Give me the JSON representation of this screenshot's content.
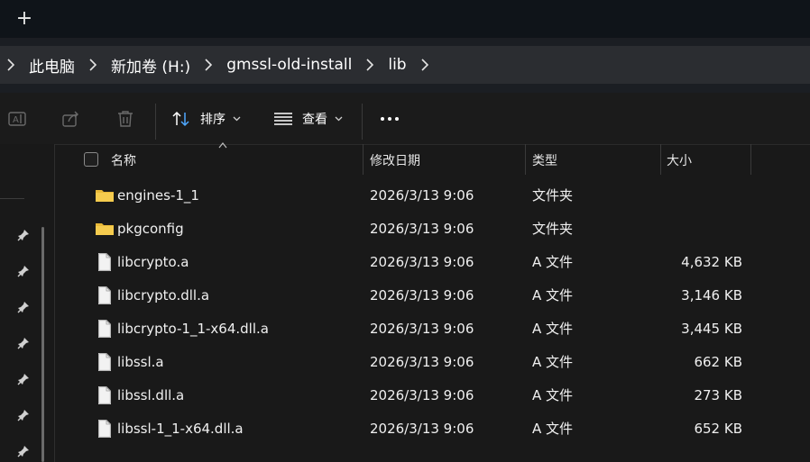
{
  "tabbar": {
    "new_tab_label": "+"
  },
  "breadcrumb": [
    "此电脑",
    "新加卷 (H:)",
    "gmssl-old-install",
    "lib"
  ],
  "toolbar": {
    "sort_label": "排序",
    "view_label": "查看"
  },
  "columns": {
    "name": "名称",
    "date": "修改日期",
    "type": "类型",
    "size": "大小"
  },
  "files": [
    {
      "name": "engines-1_1",
      "date": "2026/3/13 9:06",
      "type": "文件夹",
      "size": "",
      "icon": "folder-icon"
    },
    {
      "name": "pkgconfig",
      "date": "2026/3/13 9:06",
      "type": "文件夹",
      "size": "",
      "icon": "folder-icon"
    },
    {
      "name": "libcrypto.a",
      "date": "2026/3/13 9:06",
      "type": "A 文件",
      "size": "4,632 KB",
      "icon": "file-icon"
    },
    {
      "name": "libcrypto.dll.a",
      "date": "2026/3/13 9:06",
      "type": "A 文件",
      "size": "3,146 KB",
      "icon": "file-icon"
    },
    {
      "name": "libcrypto-1_1-x64.dll.a",
      "date": "2026/3/13 9:06",
      "type": "A 文件",
      "size": "3,445 KB",
      "icon": "file-icon"
    },
    {
      "name": "libssl.a",
      "date": "2026/3/13 9:06",
      "type": "A 文件",
      "size": "662 KB",
      "icon": "file-icon"
    },
    {
      "name": "libssl.dll.a",
      "date": "2026/3/13 9:06",
      "type": "A 文件",
      "size": "273 KB",
      "icon": "file-icon"
    },
    {
      "name": "libssl-1_1-x64.dll.a",
      "date": "2026/3/13 9:06",
      "type": "A 文件",
      "size": "652 KB",
      "icon": "file-icon"
    }
  ],
  "colors": {
    "background": "#191919",
    "folder": "#f2c94c",
    "text": "#ffffff"
  }
}
